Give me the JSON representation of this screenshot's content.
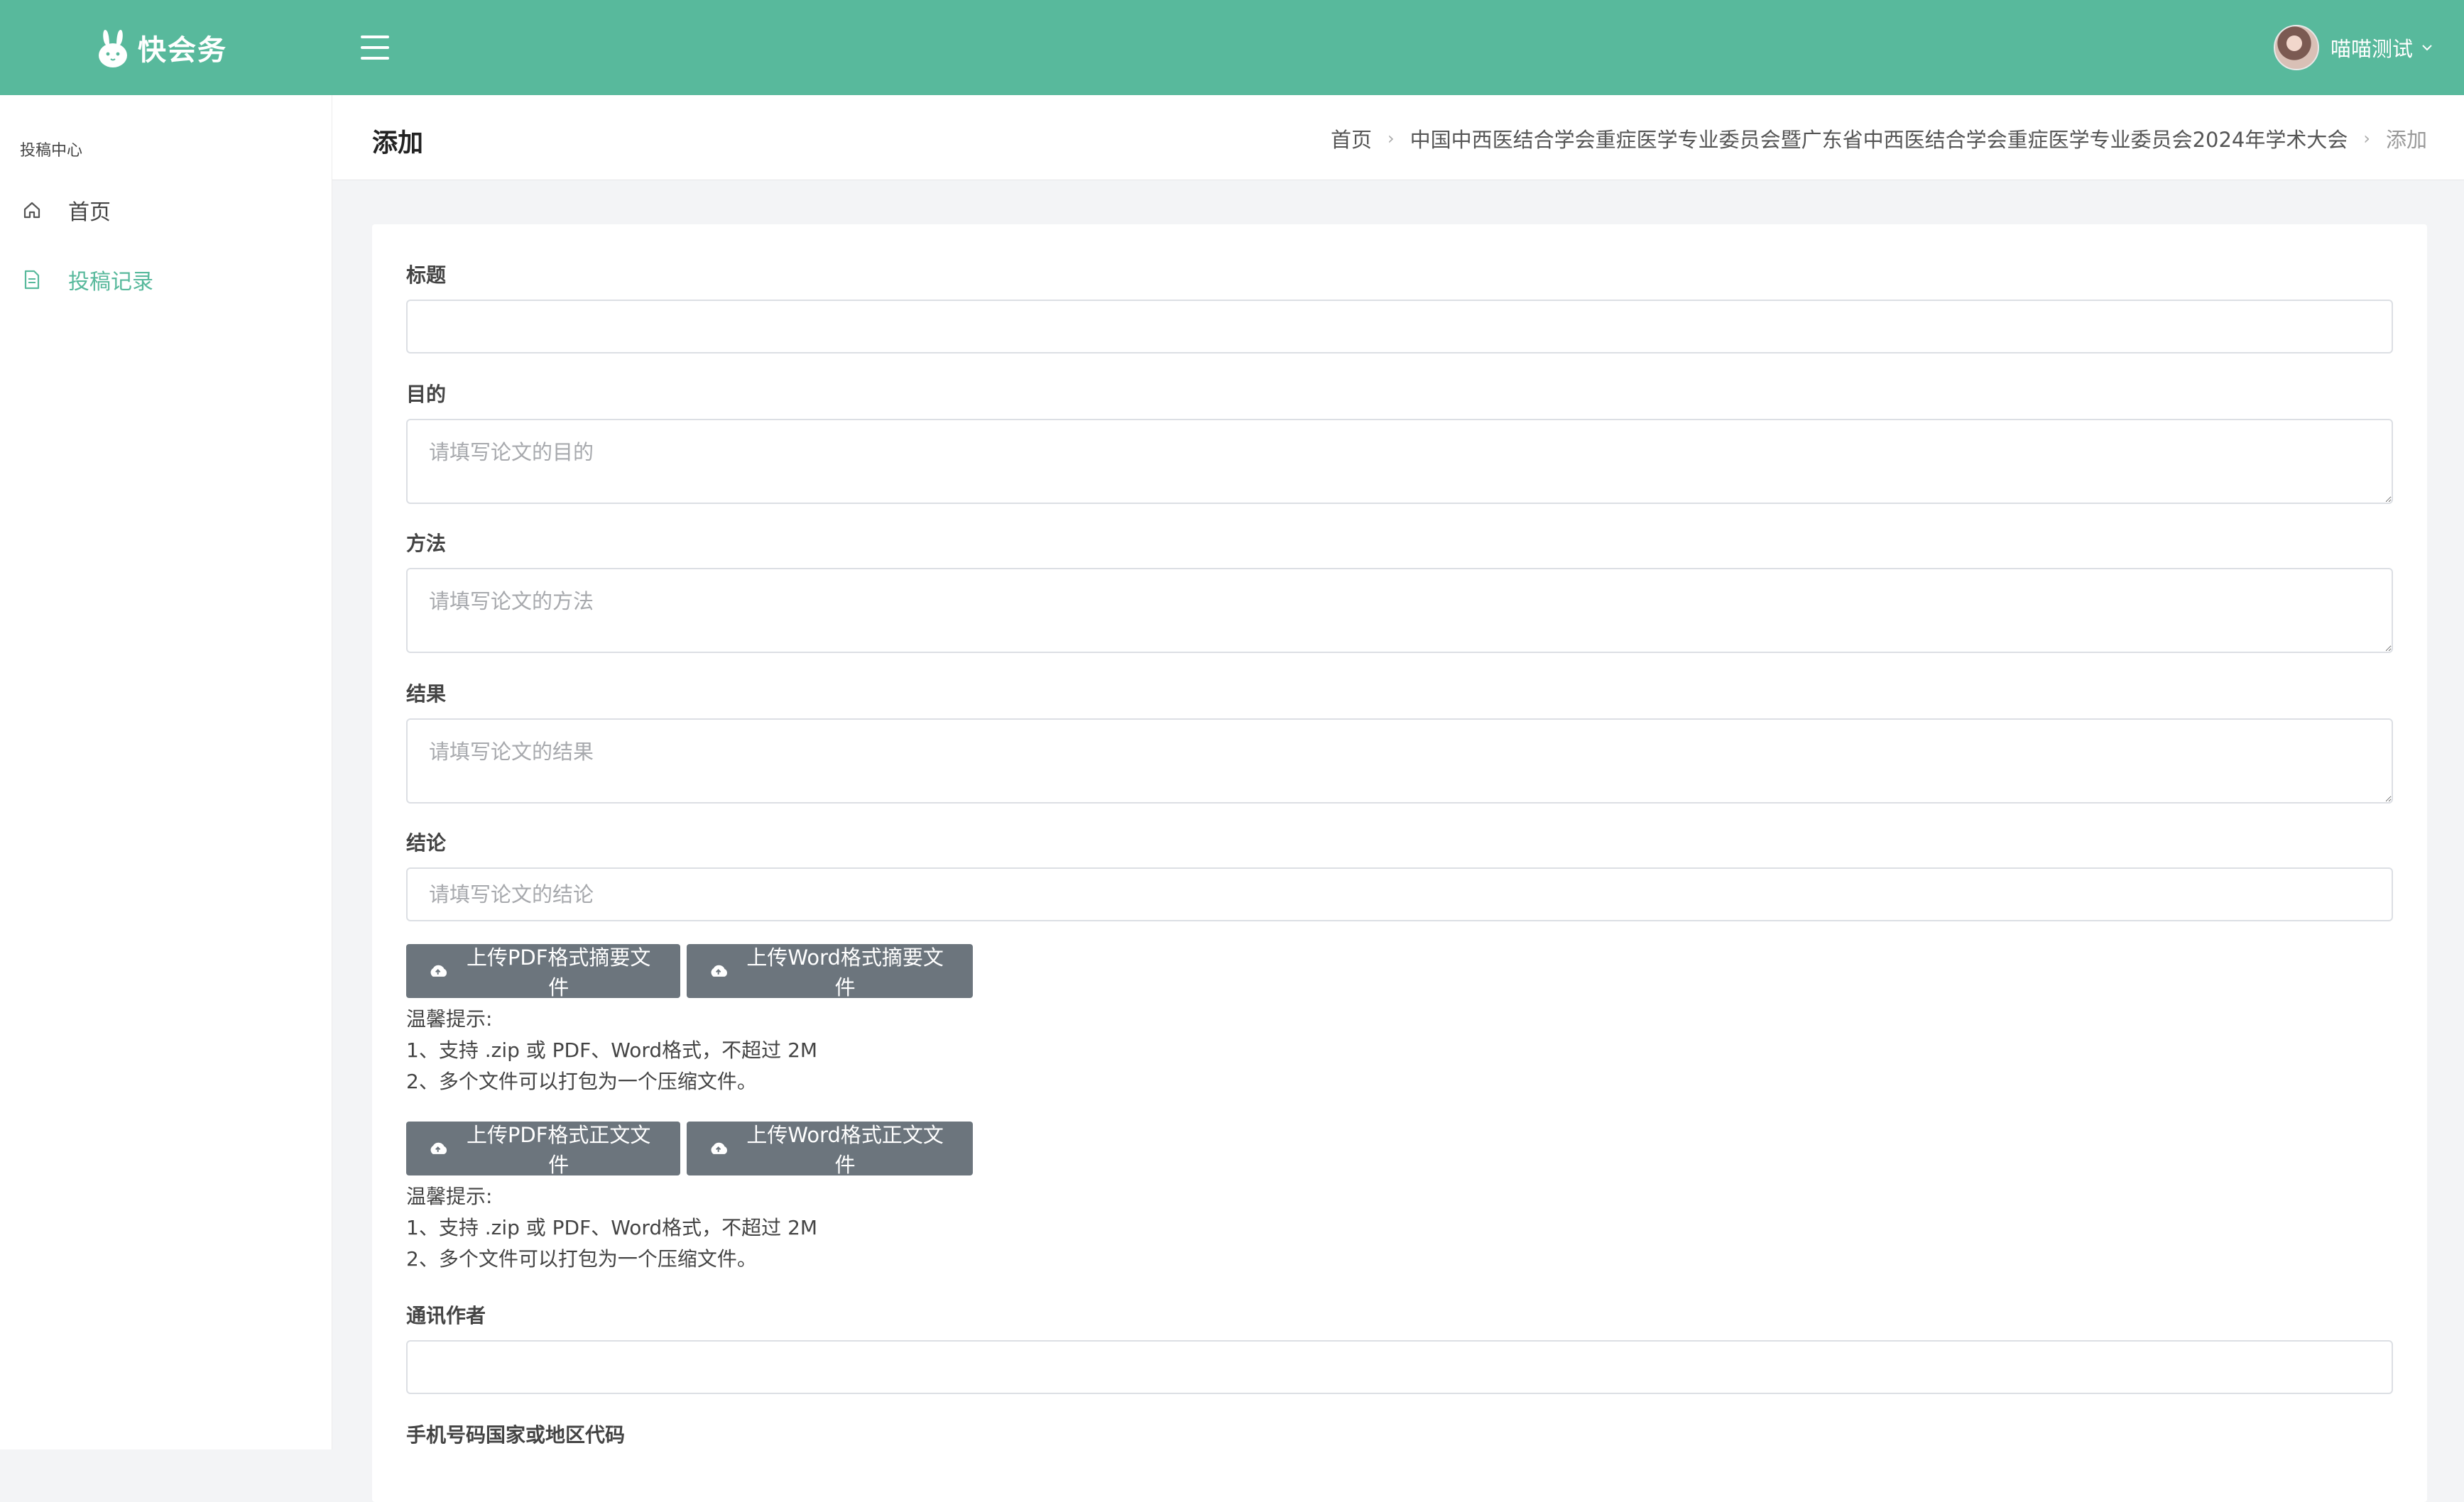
{
  "header": {
    "brand_name": "快会务",
    "user_name": "喵喵测试",
    "brand_color": "#58b99c"
  },
  "sidebar": {
    "section_title": "投稿中心",
    "items": [
      {
        "label": "首页",
        "icon": "home-icon",
        "active": false
      },
      {
        "label": "投稿记录",
        "icon": "document-icon",
        "active": true
      }
    ]
  },
  "page": {
    "title": "添加",
    "breadcrumb": [
      "首页",
      "中国中西医结合学会重症医学专业委员会暨广东省中西医结合学会重症医学专业委员会2024年学术大会",
      "添加"
    ]
  },
  "form": {
    "title_label": "标题",
    "title_value": "",
    "purpose_label": "目的",
    "purpose_placeholder": "请填写论文的目的",
    "method_label": "方法",
    "method_placeholder": "请填写论文的方法",
    "result_label": "结果",
    "result_placeholder": "请填写论文的结果",
    "conclusion_label": "结论",
    "conclusion_placeholder": "请填写论文的结论",
    "abstract_pdf_button": "上传PDF格式摘要文件",
    "abstract_word_button": "上传Word格式摘要文件",
    "abstract_hint": [
      "温馨提示:",
      "1、支持 .zip 或 PDF、Word格式，不超过 2M",
      "2、多个文件可以打包为一个压缩文件。"
    ],
    "body_pdf_button": "上传PDF格式正文文件",
    "body_word_button": "上传Word格式正文文件",
    "body_hint": [
      "温馨提示:",
      "1、支持 .zip 或 PDF、Word格式，不超过 2M",
      "2、多个文件可以打包为一个压缩文件。"
    ],
    "corresponding_author_label": "通讯作者",
    "corresponding_author_value": "",
    "phone_country_label": "手机号码国家或地区代码"
  }
}
